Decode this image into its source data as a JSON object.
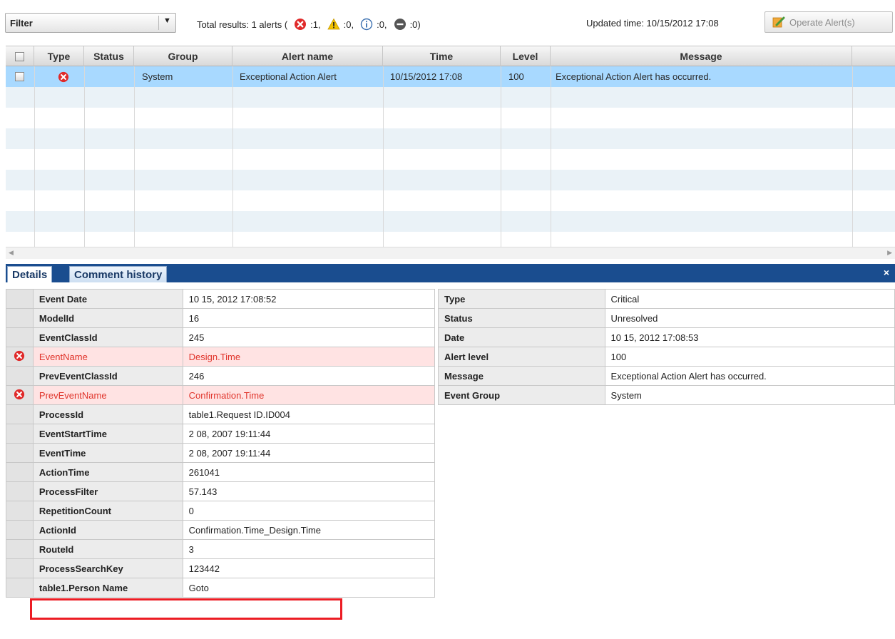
{
  "toolbar": {
    "filter_label": "Filter",
    "results_prefix": "Total results: 1 alerts (",
    "count_error": ":1,",
    "count_warning": ":0,",
    "count_info": ":0,",
    "count_unknown": ":0)",
    "updated": "Updated time: 10/15/2012 17:08",
    "operate_label": "Operate Alert(s)"
  },
  "grid": {
    "columns": [
      "Type",
      "Status",
      "Group",
      "Alert name",
      "Time",
      "Level",
      "Message"
    ],
    "rows": [
      {
        "type_icon": "error-icon",
        "status": "",
        "group": "System",
        "alert_name": "Exceptional Action Alert",
        "time": "10/15/2012 17:08",
        "level": "100",
        "message": "Exceptional Action Alert has occurred."
      }
    ]
  },
  "panel": {
    "tabs": [
      "Details",
      "Comment history"
    ],
    "close": "×"
  },
  "details_left": [
    {
      "key": "Event Date",
      "value": "10 15, 2012 17:08:52",
      "error": false
    },
    {
      "key": "ModelId",
      "value": "16",
      "error": false
    },
    {
      "key": "EventClassId",
      "value": "245",
      "error": false
    },
    {
      "key": "EventName",
      "value": "Design.Time",
      "error": true
    },
    {
      "key": "PrevEventClassId",
      "value": "246",
      "error": false
    },
    {
      "key": "PrevEventName",
      "value": "Confirmation.Time",
      "error": true
    },
    {
      "key": "ProcessId",
      "value": "table1.Request ID.ID004",
      "error": false
    },
    {
      "key": "EventStartTime",
      "value": "2 08, 2007 19:11:44",
      "error": false
    },
    {
      "key": "EventTime",
      "value": "2 08, 2007 19:11:44",
      "error": false
    },
    {
      "key": "ActionTime",
      "value": "261041",
      "error": false
    },
    {
      "key": "ProcessFilter",
      "value": "57.143",
      "error": false
    },
    {
      "key": "RepetitionCount",
      "value": "0",
      "error": false
    },
    {
      "key": "ActionId",
      "value": "Confirmation.Time_Design.Time",
      "error": false
    },
    {
      "key": "RouteId",
      "value": "3",
      "error": false
    },
    {
      "key": "ProcessSearchKey",
      "value": "123442",
      "error": false
    },
    {
      "key": "table1.Person Name",
      "value": "Goto",
      "error": false
    }
  ],
  "details_right": [
    {
      "key": "Type",
      "value": "Critical"
    },
    {
      "key": "Status",
      "value": "Unresolved"
    },
    {
      "key": "Date",
      "value": "10 15, 2012 17:08:53"
    },
    {
      "key": "Alert level",
      "value": "100"
    },
    {
      "key": "Message",
      "value": "Exceptional Action Alert has occurred."
    },
    {
      "key": "Event Group",
      "value": "System"
    }
  ],
  "colors": {
    "selected_row": "#a8d9ff",
    "tab_bar": "#1a4d8f",
    "error_text": "#e0342b",
    "highlight_box": "#ec1c24"
  }
}
